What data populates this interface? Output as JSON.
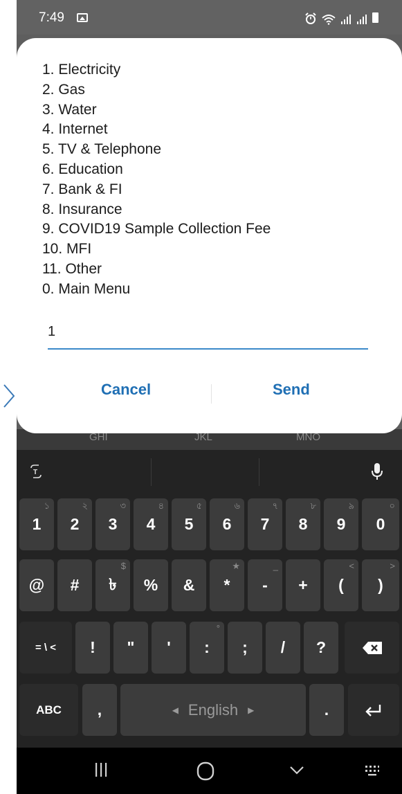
{
  "status_bar": {
    "time": "7:49",
    "icons": [
      "gallery-icon",
      "alarm-icon",
      "wifi-icon",
      "signal-icon",
      "signal-icon",
      "battery-icon"
    ]
  },
  "dialog": {
    "menu": [
      "1. Electricity",
      "2. Gas",
      "3. Water",
      "4. Internet",
      "5. TV & Telephone",
      "6. Education",
      "7. Bank & FI",
      "8. Insurance",
      "9. COVID19 Sample Collection Fee",
      "10. MFI",
      "11. Other",
      "0. Main Menu"
    ],
    "input_value": "1",
    "cancel_label": "Cancel",
    "send_label": "Send"
  },
  "keypad_hints": [
    "GHI",
    "JKL",
    "MNO"
  ],
  "keyboard": {
    "row1": [
      {
        "label": "1",
        "sub": "১"
      },
      {
        "label": "2",
        "sub": "২"
      },
      {
        "label": "3",
        "sub": "৩"
      },
      {
        "label": "4",
        "sub": "৪"
      },
      {
        "label": "5",
        "sub": "৫"
      },
      {
        "label": "6",
        "sub": "৬"
      },
      {
        "label": "7",
        "sub": "৭"
      },
      {
        "label": "8",
        "sub": "৮"
      },
      {
        "label": "9",
        "sub": "৯"
      },
      {
        "label": "0",
        "sub": "০"
      }
    ],
    "row2": [
      {
        "label": "@",
        "sub": ""
      },
      {
        "label": "#",
        "sub": ""
      },
      {
        "label": "৳",
        "sub": "$"
      },
      {
        "label": "%",
        "sub": ""
      },
      {
        "label": "&",
        "sub": ""
      },
      {
        "label": "*",
        "sub": "★"
      },
      {
        "label": "-",
        "sub": "_"
      },
      {
        "label": "+",
        "sub": ""
      },
      {
        "label": "(",
        "sub": "<"
      },
      {
        "label": ")",
        "sub": ">"
      }
    ],
    "row3": [
      {
        "label": "= \\ <",
        "sub": ""
      },
      {
        "label": "!",
        "sub": ""
      },
      {
        "label": "\"",
        "sub": ""
      },
      {
        "label": "'",
        "sub": ""
      },
      {
        "label": ":",
        "sub": "°"
      },
      {
        "label": ";",
        "sub": ""
      },
      {
        "label": "/",
        "sub": ""
      },
      {
        "label": "?",
        "sub": ""
      }
    ],
    "abc_label": "ABC",
    "comma_label": ",",
    "space_label": "English",
    "period_label": ".",
    "enter_icon": "enter-icon",
    "backspace_icon": "backspace-icon"
  },
  "nav": [
    "recents-icon",
    "home-icon",
    "back-icon",
    "keyboard-icon"
  ]
}
